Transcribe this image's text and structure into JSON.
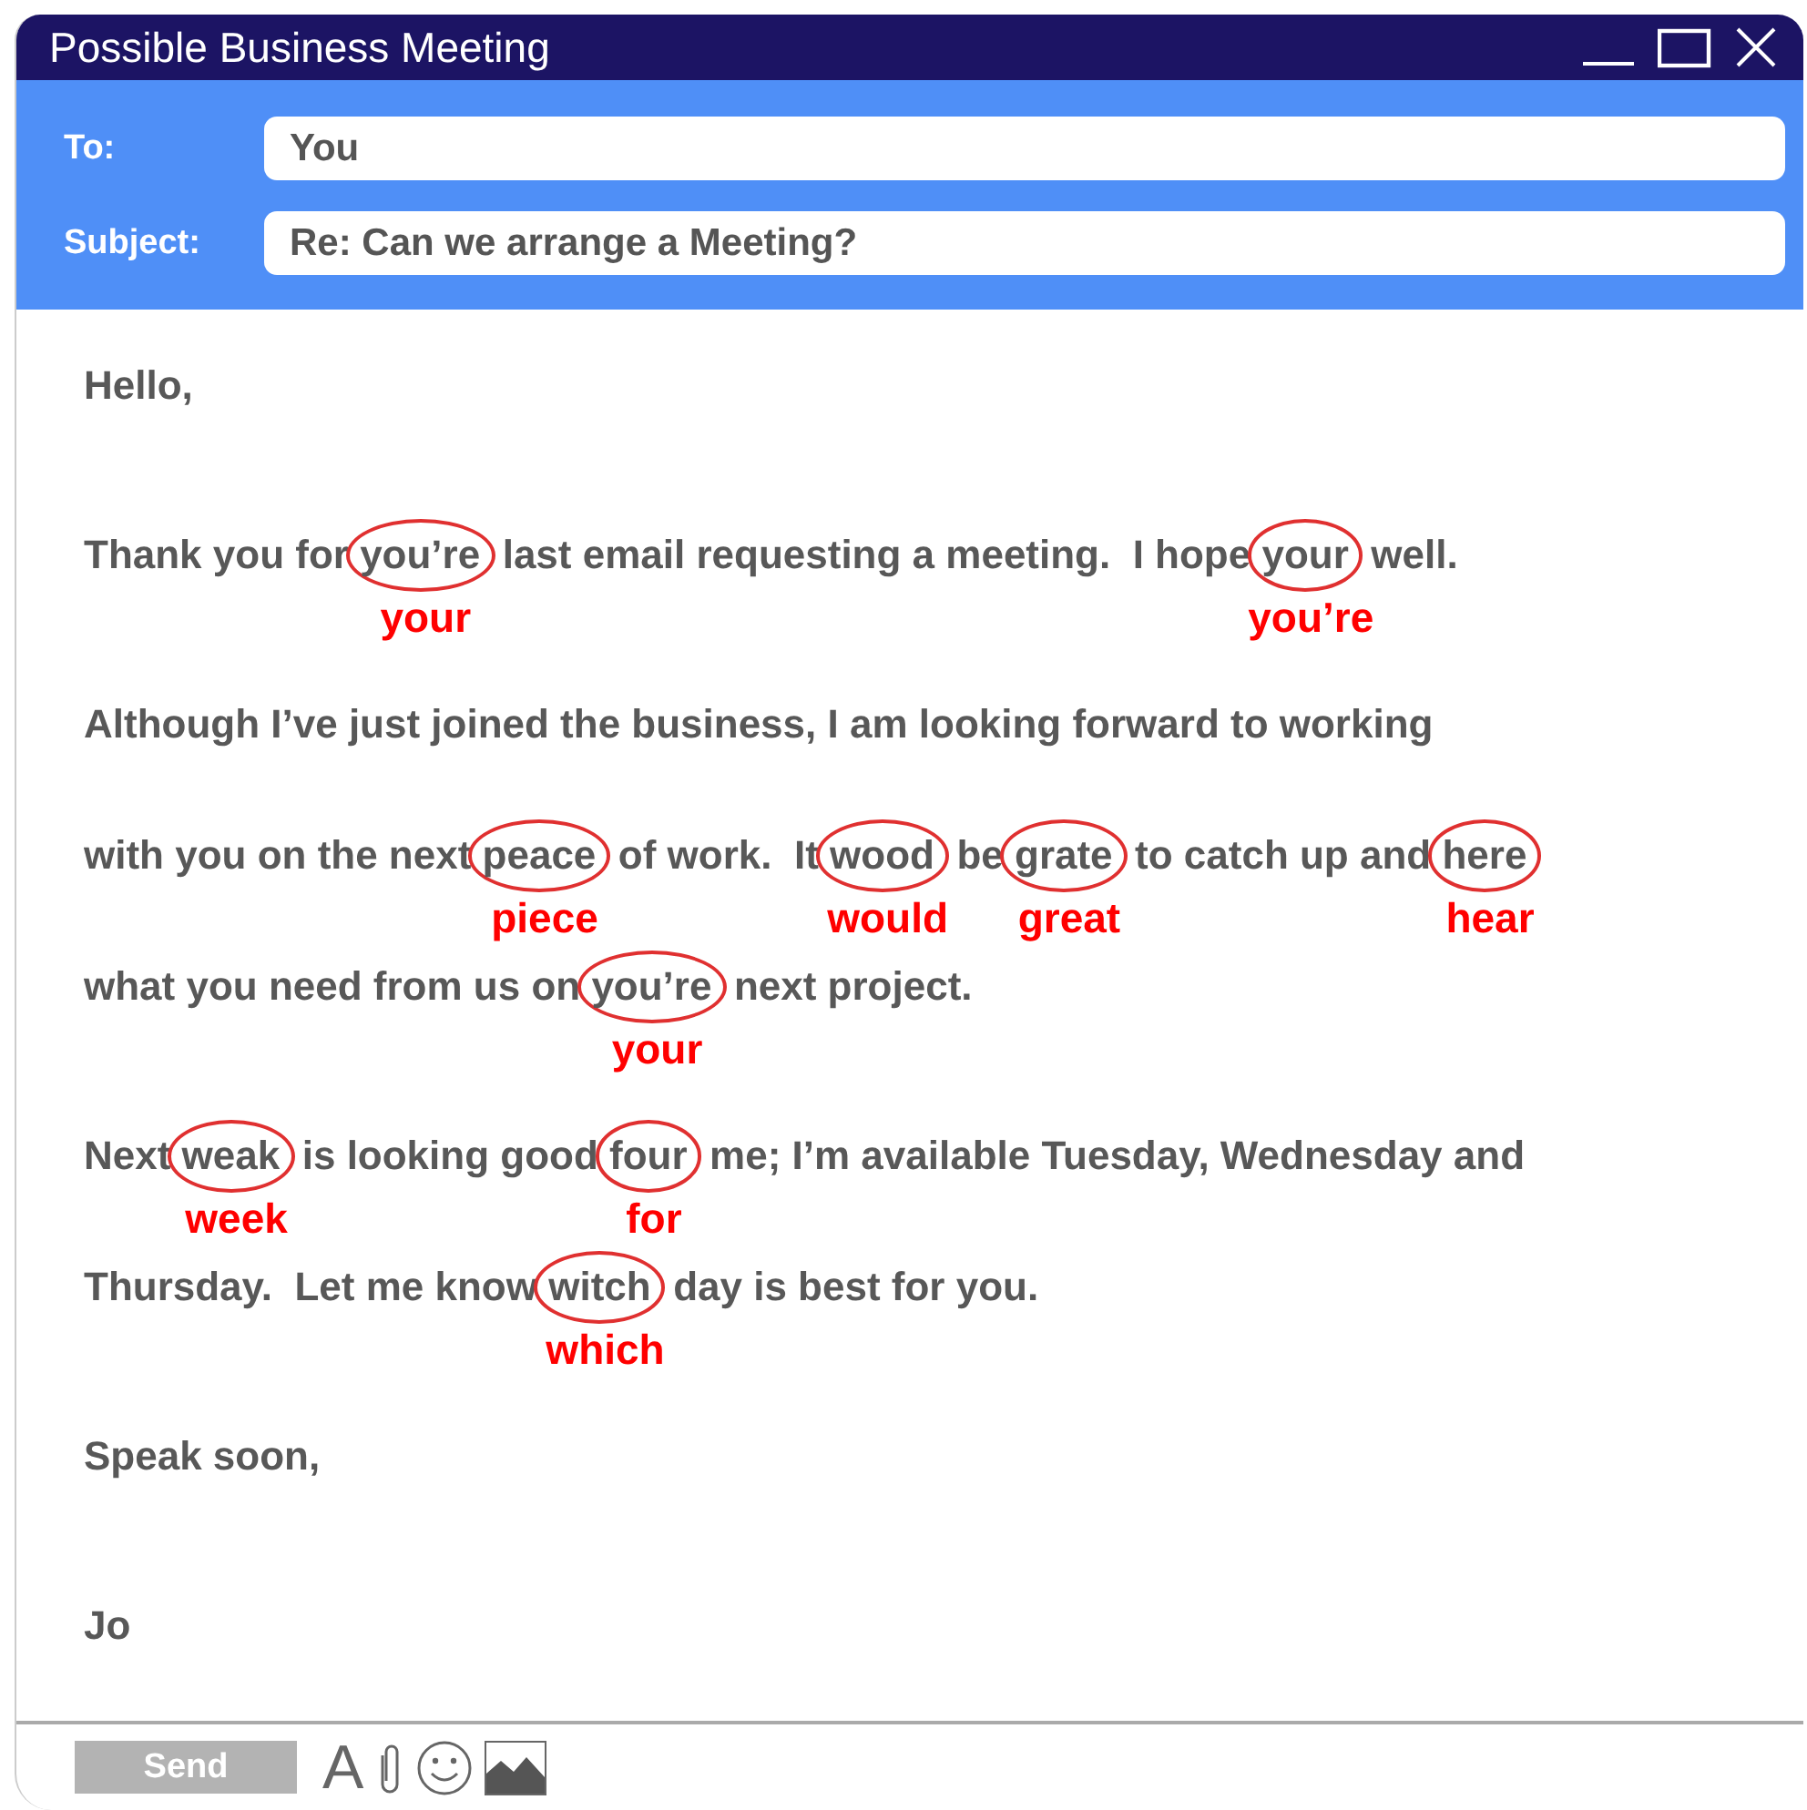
{
  "window": {
    "title": "Possible Business Meeting"
  },
  "header": {
    "to_label": "To:",
    "to": "You",
    "subject_label": "Subject:",
    "subject": "Re: Can we arrange a Meeting?"
  },
  "body": {
    "paragraphs": [
      [
        [
          {
            "kind": "plain",
            "text": "Hello,"
          }
        ]
      ],
      [
        [
          {
            "kind": "plain",
            "text": "Thank you for "
          },
          {
            "kind": "error",
            "text": "you’re",
            "correction": "your"
          },
          {
            "kind": "plain",
            "text": " last email requesting a meeting.  I hope "
          },
          {
            "kind": "error",
            "text": "your",
            "correction": "you’re"
          },
          {
            "kind": "plain",
            "text": " well."
          }
        ]
      ],
      [
        [
          {
            "kind": "plain",
            "text": "Although I’ve just joined the business, I am looking forward to working"
          }
        ],
        [
          {
            "kind": "plain",
            "text": "with you on the next "
          },
          {
            "kind": "error",
            "text": "peace",
            "correction": "piece"
          },
          {
            "kind": "plain",
            "text": " of work.  It "
          },
          {
            "kind": "error",
            "text": "wood",
            "correction": "would"
          },
          {
            "kind": "plain",
            "text": " be "
          },
          {
            "kind": "error",
            "text": "grate",
            "correction": "great"
          },
          {
            "kind": "plain",
            "text": " to catch up and "
          },
          {
            "kind": "error",
            "text": "here",
            "correction": "hear"
          }
        ],
        [
          {
            "kind": "plain",
            "text": "what you need from us on "
          },
          {
            "kind": "error",
            "text": "you’re",
            "correction": "your"
          },
          {
            "kind": "plain",
            "text": " next project."
          }
        ]
      ],
      [
        [
          {
            "kind": "plain",
            "text": "Next "
          },
          {
            "kind": "error",
            "text": "weak",
            "correction": "week"
          },
          {
            "kind": "plain",
            "text": " is looking good "
          },
          {
            "kind": "error",
            "text": "four",
            "correction": "for"
          },
          {
            "kind": "plain",
            "text": " me; I’m available Tuesday, Wednesday and"
          }
        ],
        [
          {
            "kind": "plain",
            "text": "Thursday.  Let me know "
          },
          {
            "kind": "error",
            "text": "witch",
            "correction": "which"
          },
          {
            "kind": "plain",
            "text": " day is best for you."
          }
        ]
      ],
      [
        [
          {
            "kind": "plain",
            "text": "Speak soon,"
          }
        ]
      ],
      [
        [
          {
            "kind": "plain",
            "text": "Jo"
          }
        ]
      ]
    ]
  },
  "toolbar": {
    "send": "Send",
    "font": "A"
  }
}
